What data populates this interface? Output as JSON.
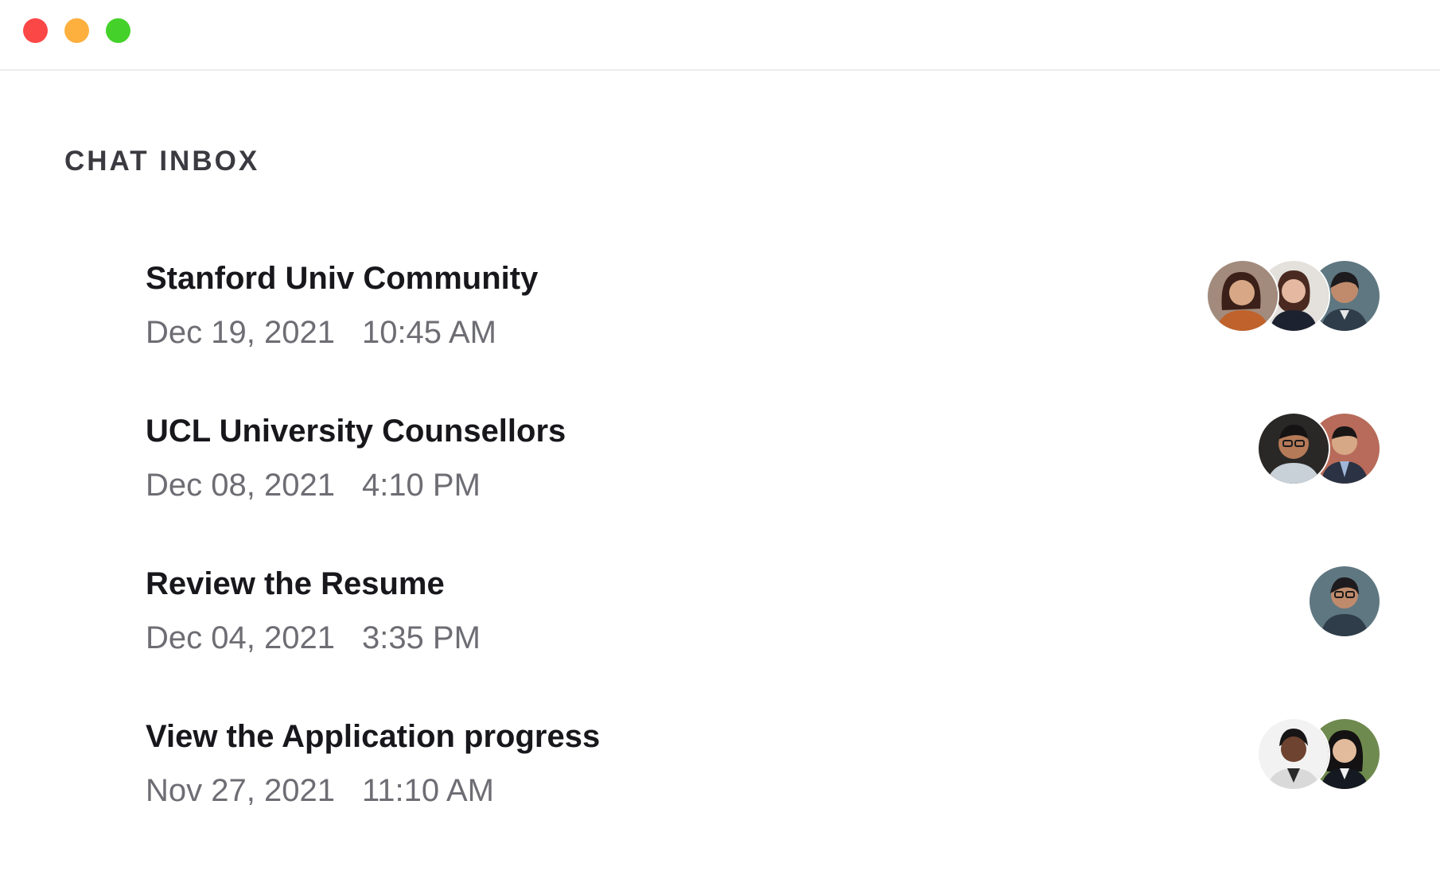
{
  "window": {
    "controls": [
      "close",
      "minimize",
      "zoom"
    ],
    "colors": {
      "close": "#fc4747",
      "minimize": "#fdb03e",
      "zoom": "#44d12a"
    }
  },
  "inbox": {
    "title": "CHAT INBOX"
  },
  "chats": [
    {
      "name": "Stanford Univ Community",
      "date": "Dec 19, 2021",
      "time": "10:45 AM",
      "avatars": [
        "participant-avatar",
        "participant-avatar",
        "participant-avatar"
      ]
    },
    {
      "name": "UCL  University Counsellors",
      "date": "Dec 08, 2021",
      "time": "4:10 PM",
      "avatars": [
        "participant-avatar",
        "participant-avatar"
      ]
    },
    {
      "name": "Review the Resume",
      "date": "Dec 04, 2021",
      "time": "3:35 PM",
      "avatars": [
        "participant-avatar"
      ]
    },
    {
      "name": "View the Application progress",
      "date": "Nov 27, 2021",
      "time": "11:10 AM",
      "avatars": [
        "participant-avatar",
        "participant-avatar"
      ]
    }
  ]
}
